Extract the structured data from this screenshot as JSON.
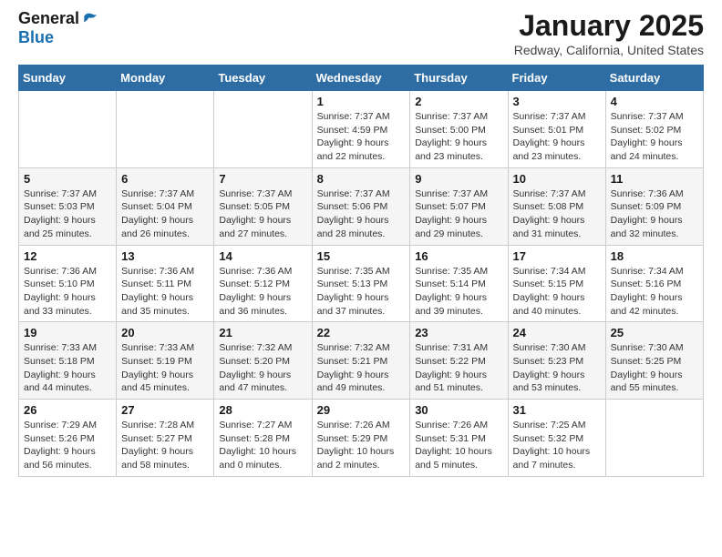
{
  "header": {
    "logo_general": "General",
    "logo_blue": "Blue",
    "month": "January 2025",
    "location": "Redway, California, United States"
  },
  "weekdays": [
    "Sunday",
    "Monday",
    "Tuesday",
    "Wednesday",
    "Thursday",
    "Friday",
    "Saturday"
  ],
  "weeks": [
    [
      {
        "num": "",
        "info": ""
      },
      {
        "num": "",
        "info": ""
      },
      {
        "num": "",
        "info": ""
      },
      {
        "num": "1",
        "info": "Sunrise: 7:37 AM\nSunset: 4:59 PM\nDaylight: 9 hours\nand 22 minutes."
      },
      {
        "num": "2",
        "info": "Sunrise: 7:37 AM\nSunset: 5:00 PM\nDaylight: 9 hours\nand 23 minutes."
      },
      {
        "num": "3",
        "info": "Sunrise: 7:37 AM\nSunset: 5:01 PM\nDaylight: 9 hours\nand 23 minutes."
      },
      {
        "num": "4",
        "info": "Sunrise: 7:37 AM\nSunset: 5:02 PM\nDaylight: 9 hours\nand 24 minutes."
      }
    ],
    [
      {
        "num": "5",
        "info": "Sunrise: 7:37 AM\nSunset: 5:03 PM\nDaylight: 9 hours\nand 25 minutes."
      },
      {
        "num": "6",
        "info": "Sunrise: 7:37 AM\nSunset: 5:04 PM\nDaylight: 9 hours\nand 26 minutes."
      },
      {
        "num": "7",
        "info": "Sunrise: 7:37 AM\nSunset: 5:05 PM\nDaylight: 9 hours\nand 27 minutes."
      },
      {
        "num": "8",
        "info": "Sunrise: 7:37 AM\nSunset: 5:06 PM\nDaylight: 9 hours\nand 28 minutes."
      },
      {
        "num": "9",
        "info": "Sunrise: 7:37 AM\nSunset: 5:07 PM\nDaylight: 9 hours\nand 29 minutes."
      },
      {
        "num": "10",
        "info": "Sunrise: 7:37 AM\nSunset: 5:08 PM\nDaylight: 9 hours\nand 31 minutes."
      },
      {
        "num": "11",
        "info": "Sunrise: 7:36 AM\nSunset: 5:09 PM\nDaylight: 9 hours\nand 32 minutes."
      }
    ],
    [
      {
        "num": "12",
        "info": "Sunrise: 7:36 AM\nSunset: 5:10 PM\nDaylight: 9 hours\nand 33 minutes."
      },
      {
        "num": "13",
        "info": "Sunrise: 7:36 AM\nSunset: 5:11 PM\nDaylight: 9 hours\nand 35 minutes."
      },
      {
        "num": "14",
        "info": "Sunrise: 7:36 AM\nSunset: 5:12 PM\nDaylight: 9 hours\nand 36 minutes."
      },
      {
        "num": "15",
        "info": "Sunrise: 7:35 AM\nSunset: 5:13 PM\nDaylight: 9 hours\nand 37 minutes."
      },
      {
        "num": "16",
        "info": "Sunrise: 7:35 AM\nSunset: 5:14 PM\nDaylight: 9 hours\nand 39 minutes."
      },
      {
        "num": "17",
        "info": "Sunrise: 7:34 AM\nSunset: 5:15 PM\nDaylight: 9 hours\nand 40 minutes."
      },
      {
        "num": "18",
        "info": "Sunrise: 7:34 AM\nSunset: 5:16 PM\nDaylight: 9 hours\nand 42 minutes."
      }
    ],
    [
      {
        "num": "19",
        "info": "Sunrise: 7:33 AM\nSunset: 5:18 PM\nDaylight: 9 hours\nand 44 minutes."
      },
      {
        "num": "20",
        "info": "Sunrise: 7:33 AM\nSunset: 5:19 PM\nDaylight: 9 hours\nand 45 minutes."
      },
      {
        "num": "21",
        "info": "Sunrise: 7:32 AM\nSunset: 5:20 PM\nDaylight: 9 hours\nand 47 minutes."
      },
      {
        "num": "22",
        "info": "Sunrise: 7:32 AM\nSunset: 5:21 PM\nDaylight: 9 hours\nand 49 minutes."
      },
      {
        "num": "23",
        "info": "Sunrise: 7:31 AM\nSunset: 5:22 PM\nDaylight: 9 hours\nand 51 minutes."
      },
      {
        "num": "24",
        "info": "Sunrise: 7:30 AM\nSunset: 5:23 PM\nDaylight: 9 hours\nand 53 minutes."
      },
      {
        "num": "25",
        "info": "Sunrise: 7:30 AM\nSunset: 5:25 PM\nDaylight: 9 hours\nand 55 minutes."
      }
    ],
    [
      {
        "num": "26",
        "info": "Sunrise: 7:29 AM\nSunset: 5:26 PM\nDaylight: 9 hours\nand 56 minutes."
      },
      {
        "num": "27",
        "info": "Sunrise: 7:28 AM\nSunset: 5:27 PM\nDaylight: 9 hours\nand 58 minutes."
      },
      {
        "num": "28",
        "info": "Sunrise: 7:27 AM\nSunset: 5:28 PM\nDaylight: 10 hours\nand 0 minutes."
      },
      {
        "num": "29",
        "info": "Sunrise: 7:26 AM\nSunset: 5:29 PM\nDaylight: 10 hours\nand 2 minutes."
      },
      {
        "num": "30",
        "info": "Sunrise: 7:26 AM\nSunset: 5:31 PM\nDaylight: 10 hours\nand 5 minutes."
      },
      {
        "num": "31",
        "info": "Sunrise: 7:25 AM\nSunset: 5:32 PM\nDaylight: 10 hours\nand 7 minutes."
      },
      {
        "num": "",
        "info": ""
      }
    ]
  ]
}
